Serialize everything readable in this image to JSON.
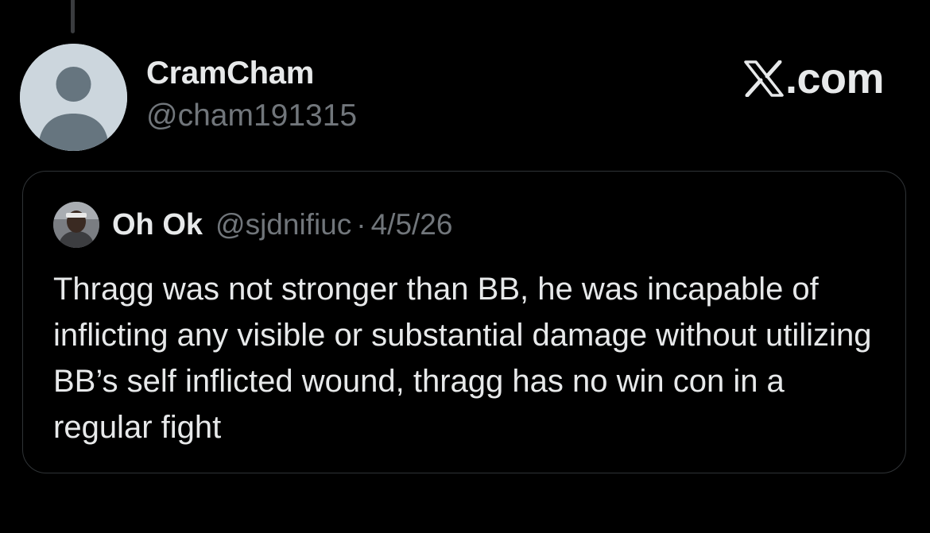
{
  "tweet": {
    "author": {
      "display_name": "CramCham",
      "handle": "@cham191315",
      "avatar_icon": "default-profile-icon"
    },
    "brand": {
      "logo_icon": "x-logo-icon",
      "text": ".com"
    },
    "quoted_tweet": {
      "author": {
        "display_name": "Oh Ok",
        "handle": "@sjdnifiuc",
        "avatar_icon": "profile-photo"
      },
      "separator": "·",
      "date": "4/5/26",
      "text": "Thragg was not stronger than BB, he was incapable of inflicting any visible or substantial damage without utilizing BB’s self inflicted wound, thragg has no win con in a regular fight"
    }
  },
  "colors": {
    "background": "#000000",
    "primary_text": "#e7e9ea",
    "secondary_text": "#71767b",
    "border": "#2f3336",
    "default_avatar": "#ccd6dd"
  }
}
